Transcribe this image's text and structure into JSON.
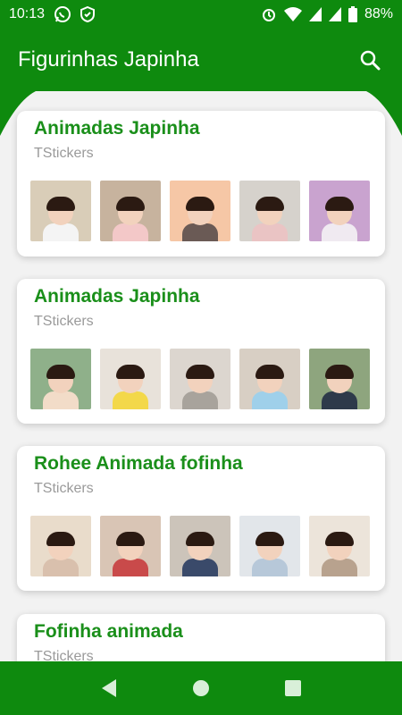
{
  "status": {
    "time": "10:13",
    "battery": "88%",
    "icons_left": [
      "whatsapp-icon",
      "shield-icon"
    ],
    "icons_right": [
      "alarm-icon",
      "wifi-icon",
      "signal-icon",
      "signal-icon",
      "battery-icon"
    ]
  },
  "app": {
    "title": "Figurinhas Japinha",
    "search_icon": "search-icon"
  },
  "colors": {
    "primary": "#0e8a0e",
    "title": "#1a8f1a",
    "subtitle": "#9a9a9a"
  },
  "packs": [
    {
      "title": "Animadas Japinha",
      "author": "TStickers",
      "thumbs": [
        {
          "bg": "#d9cdb8",
          "body": "#f4f4f4"
        },
        {
          "bg": "#c7b39e",
          "body": "#f3c8c8"
        },
        {
          "bg": "#f6c7a6",
          "body": "#6a5a55"
        },
        {
          "bg": "#d6d2cc",
          "body": "#eac4c4"
        },
        {
          "bg": "#c9a3cf",
          "body": "#f0eaf1"
        }
      ]
    },
    {
      "title": "Animadas Japinha",
      "author": "TStickers",
      "thumbs": [
        {
          "bg": "#8fb08a",
          "body": "#f2dcc8"
        },
        {
          "bg": "#e8e2da",
          "body": "#f3d84a"
        },
        {
          "bg": "#dcd6cf",
          "body": "#a8a39c"
        },
        {
          "bg": "#d8cfc4",
          "body": "#9fd0ea"
        },
        {
          "bg": "#8ea57e",
          "body": "#2e3a4a"
        }
      ]
    },
    {
      "title": "Rohee Animada fofinha",
      "author": "TStickers",
      "thumbs": [
        {
          "bg": "#e9dccb",
          "body": "#d9c0ad"
        },
        {
          "bg": "#d9c5b5",
          "body": "#c94a4a"
        },
        {
          "bg": "#ccc4ba",
          "body": "#3a4a6a"
        },
        {
          "bg": "#e2e6ea",
          "body": "#b7c8d9"
        },
        {
          "bg": "#ece4da",
          "body": "#b8a28e"
        }
      ]
    },
    {
      "title": "Fofinha animada",
      "author": "TStickers",
      "thumbs": []
    }
  ],
  "nav": {
    "back_icon": "back-icon",
    "home_icon": "home-icon",
    "recents_icon": "recents-icon"
  }
}
